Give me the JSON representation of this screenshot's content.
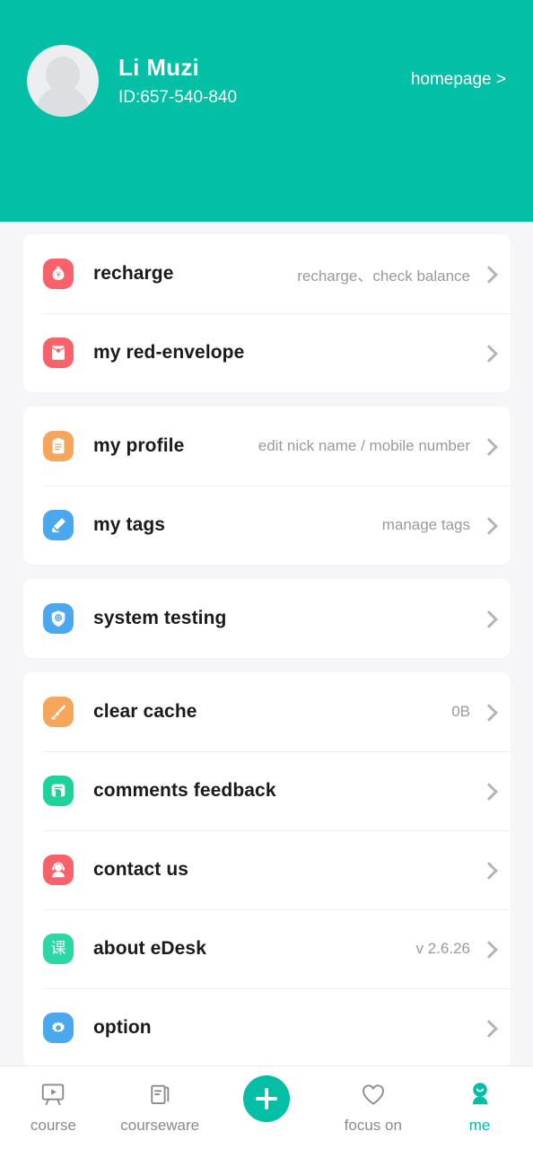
{
  "header": {
    "avatar_icon": "default-user-avatar",
    "user_name": "Li Muzi",
    "user_id": "ID:657-540-840",
    "homepage_link": "homepage >",
    "background_color": "#02bfa5"
  },
  "sections": [
    {
      "rows": [
        {
          "icon": "money-bag-icon",
          "icon_color": "#f9626a",
          "label": "recharge",
          "value": "recharge、check balance"
        },
        {
          "icon": "red-envelope-icon",
          "icon_color": "#f9626a",
          "label": "my red-envelope",
          "value": ""
        }
      ]
    },
    {
      "rows": [
        {
          "icon": "clipboard-icon",
          "icon_color": "#f7a55a",
          "label": "my profile",
          "value": "edit nick name / mobile number"
        },
        {
          "icon": "pencil-icon",
          "icon_color": "#4aa8ef",
          "label": "my tags",
          "value": "manage tags"
        }
      ]
    },
    {
      "rows": [
        {
          "icon": "shield-check-icon",
          "icon_color": "#4aa8ef",
          "label": "system testing",
          "value": ""
        }
      ]
    },
    {
      "rows": [
        {
          "icon": "broom-icon",
          "icon_color": "#f7a55a",
          "label": "clear cache",
          "value": "0B"
        },
        {
          "icon": "feedback-message-icon",
          "icon_color": "#1fd19a",
          "label": "comments feedback",
          "value": ""
        },
        {
          "icon": "headset-support-icon",
          "icon_color": "#f9626a",
          "label": "contact us",
          "value": ""
        },
        {
          "icon": "app-logo-icon",
          "icon_glyph": "课",
          "icon_color": "#2bd7a4",
          "label": "about eDesk",
          "value": "v 2.6.26"
        },
        {
          "icon": "gear-icon",
          "icon_color": "#4aa8ef",
          "label": "option",
          "value": ""
        }
      ]
    }
  ],
  "tabbar": {
    "active_color": "#02bfa5",
    "items": [
      {
        "icon": "whiteboard-play-icon",
        "label": "course",
        "active": false
      },
      {
        "icon": "courseware-document-icon",
        "label": "courseware",
        "active": false
      },
      {
        "icon": "plus-icon",
        "label": "",
        "active": false
      },
      {
        "icon": "heart-icon",
        "label": "focus on",
        "active": false
      },
      {
        "icon": "person-avatar-icon",
        "label": "me",
        "active": true
      }
    ]
  }
}
